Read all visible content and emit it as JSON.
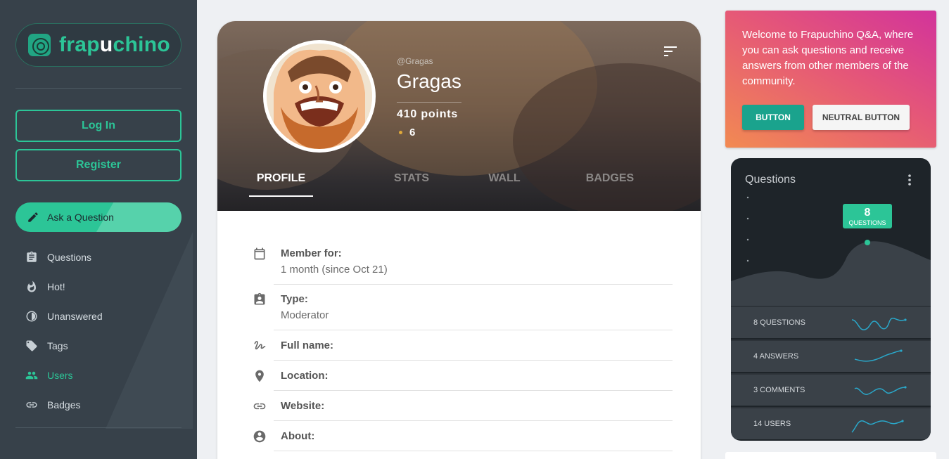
{
  "sidebar": {
    "logo": {
      "text_a": "frap",
      "text_u": "u",
      "text_b": "chino"
    },
    "login_label": "Log In",
    "register_label": "Register",
    "ask_label": "Ask a Question",
    "items": [
      {
        "label": "Questions",
        "icon": "clipboard-icon"
      },
      {
        "label": "Hot!",
        "icon": "flame-icon"
      },
      {
        "label": "Unanswered",
        "icon": "half-circle-icon"
      },
      {
        "label": "Tags",
        "icon": "tag-icon"
      },
      {
        "label": "Users",
        "icon": "users-icon",
        "active": true
      },
      {
        "label": "Badges",
        "icon": "link-icon"
      }
    ]
  },
  "profile": {
    "handle": "@Gragas",
    "name": "Gragas",
    "points": "410 points",
    "badges": "6",
    "tabs": [
      "PROFILE",
      "STATS",
      "WALL",
      "BADGES"
    ],
    "fields": [
      {
        "label": "Member for:",
        "value": "1 month (since Oct 21)",
        "icon": "calendar-icon"
      },
      {
        "label": "Type:",
        "value": "Moderator",
        "icon": "badge-id-icon"
      },
      {
        "label": "Full name:",
        "value": "",
        "icon": "signature-icon"
      },
      {
        "label": "Location:",
        "value": "",
        "icon": "location-pin-icon"
      },
      {
        "label": "Website:",
        "value": "",
        "icon": "link-icon"
      },
      {
        "label": "About:",
        "value": "",
        "icon": "account-circle-icon"
      }
    ]
  },
  "welcome": {
    "text": "Welcome to Frapuchino Q&A, where you can ask questions and receive answers from other members of the community.",
    "button_label": "BUTTON",
    "neutral_button_label": "NEUTRAL BUTTON"
  },
  "stats_widget": {
    "title": "Questions",
    "tooltip_value": "8",
    "tooltip_label": "QUESTIONS",
    "rows": [
      {
        "label": "8 QUESTIONS"
      },
      {
        "label": "4 ANSWERS"
      },
      {
        "label": "3 COMMENTS"
      },
      {
        "label": "14 USERS"
      }
    ]
  },
  "colors": {
    "accent": "#2cc597",
    "sidebar_bg": "#37414a",
    "stats_bg": "#1e2429",
    "sparkline": "#2aa7c9"
  }
}
